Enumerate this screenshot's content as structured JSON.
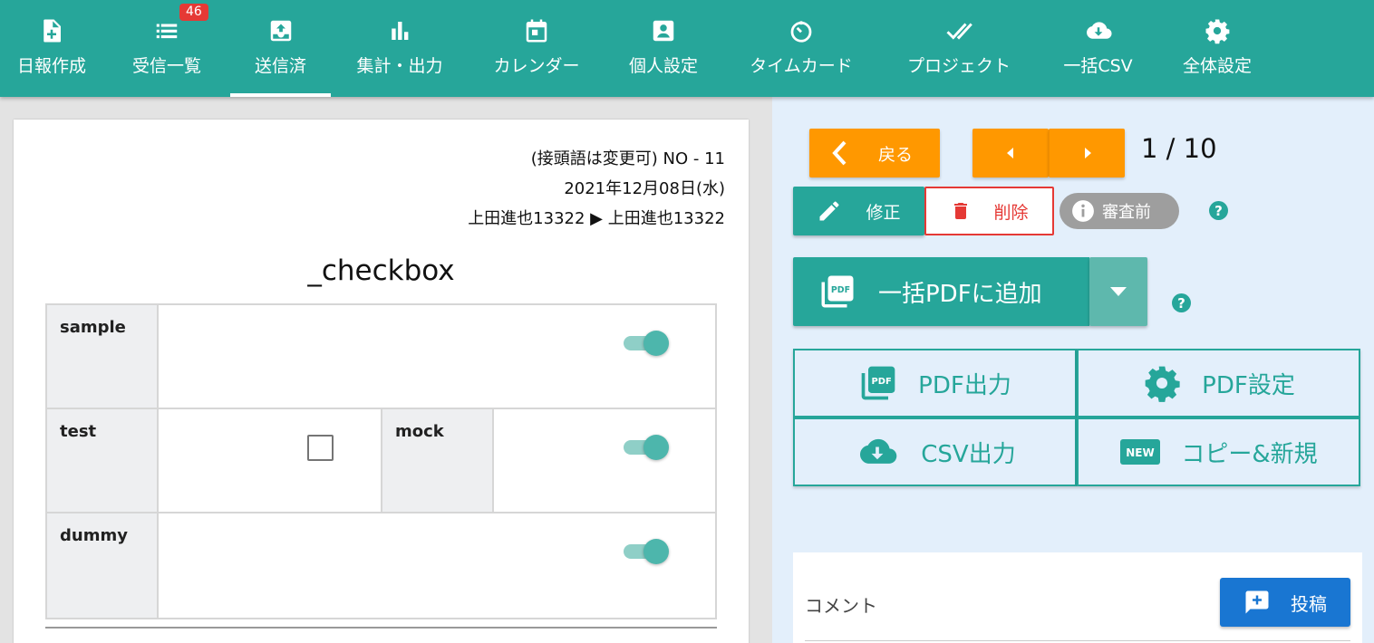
{
  "nav": {
    "items": [
      {
        "label": "日報作成",
        "icon": "file-plus-icon"
      },
      {
        "label": "受信一覧",
        "icon": "list-icon",
        "badge": "46"
      },
      {
        "label": "送信済",
        "icon": "outbox-icon",
        "active": true
      },
      {
        "label": "集計・出力",
        "icon": "bar-chart-icon"
      },
      {
        "label": "カレンダー",
        "icon": "calendar-icon"
      },
      {
        "label": "個人設定",
        "icon": "account-box-icon"
      },
      {
        "label": "タイムカード",
        "icon": "timer-icon"
      },
      {
        "label": "プロジェクト",
        "icon": "double-check-icon"
      },
      {
        "label": "一括CSV",
        "icon": "cloud-download-icon"
      },
      {
        "label": "全体設定",
        "icon": "gear-icon"
      }
    ]
  },
  "report": {
    "number_line": "(接頭語は変更可) NO - 11",
    "date_line": "2021年12月08日(水)",
    "route_line": "上田進也13322 ▶ 上田進也13322",
    "title": "_checkbox",
    "fields": {
      "sample": {
        "label": "sample",
        "value": true
      },
      "test": {
        "label": "test",
        "value": false
      },
      "mock": {
        "label": "mock",
        "value": true
      },
      "dummy": {
        "label": "dummy",
        "value": true
      }
    }
  },
  "actions": {
    "back_label": "戻る",
    "pager": "1 / 10",
    "edit_label": "修正",
    "delete_label": "削除",
    "status_label": "審査前",
    "help_mark": "?",
    "bulk_pdf_label": "一括PDFに追加",
    "pdf_output_label": "PDF出力",
    "pdf_settings_label": "PDF設定",
    "csv_output_label": "CSV出力",
    "copy_new_label": "コピー&新規"
  },
  "comments": {
    "label": "コメント",
    "post_label": "投稿"
  },
  "colors": {
    "primary": "#26a69a",
    "orange": "#ff9800",
    "danger": "#e53935",
    "blue": "#1976d2",
    "panel_bg": "#e3effb"
  }
}
